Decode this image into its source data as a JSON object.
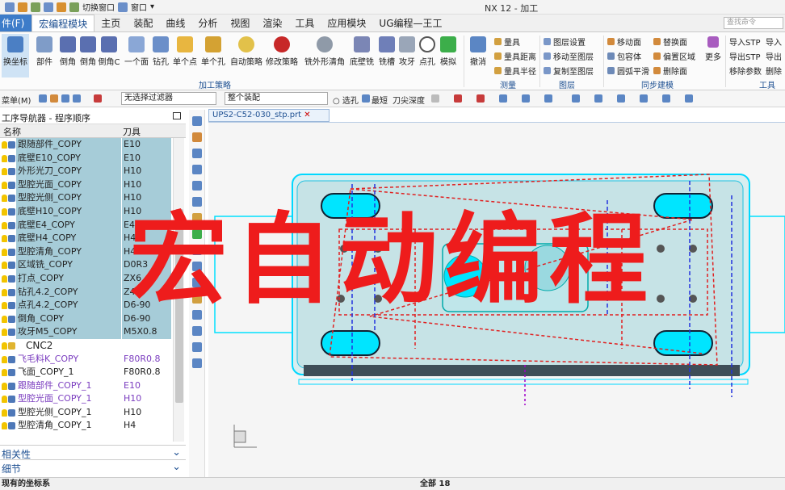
{
  "window": {
    "title": "NX 12 - 加工",
    "qat_switch_window": "切换窗口",
    "qat_window": "窗口"
  },
  "tabs": [
    {
      "label": "件(F)"
    },
    {
      "label": "宏编程模块"
    },
    {
      "label": "主页"
    },
    {
      "label": "装配"
    },
    {
      "label": "曲线"
    },
    {
      "label": "分析"
    },
    {
      "label": "视图"
    },
    {
      "label": "渲染"
    },
    {
      "label": "工具"
    },
    {
      "label": "应用模块"
    },
    {
      "label": "UG编程—王工"
    }
  ],
  "search": {
    "placeholder": "查找命令"
  },
  "ribbon": {
    "big_buttons": [
      {
        "label": "换坐标"
      },
      {
        "label": "部件"
      },
      {
        "label": "倒角"
      },
      {
        "label": "倒角"
      },
      {
        "label": "倒角C"
      },
      {
        "label": "一个面"
      },
      {
        "label": "钻孔"
      },
      {
        "label": "单个点"
      },
      {
        "label": "单个孔"
      },
      {
        "label": "自动策略"
      },
      {
        "label": "修改策略"
      },
      {
        "label": "铣外形清角"
      },
      {
        "label": "底壁铣"
      },
      {
        "label": "铣槽"
      },
      {
        "label": "攻牙"
      },
      {
        "label": "点孔"
      },
      {
        "label": "模拟"
      },
      {
        "label": "撤消"
      }
    ],
    "measure_items": [
      "量具",
      "量具距离",
      "量具半径"
    ],
    "layer_items": [
      "图层设置",
      "移动至图层",
      "复制至图层"
    ],
    "sync_items": [
      "移动面",
      "包容体",
      "圆弧平滑",
      "替换面",
      "偏置区域",
      "删除面"
    ],
    "more_label": "更多",
    "tool_items": [
      "导入STP",
      "导出STP",
      "移除参数",
      "导入",
      "导出",
      "删除"
    ],
    "group_labels": {
      "machining": "加工策略",
      "measure": "测量",
      "layer": "图层",
      "sync": "同步建模",
      "tools": "工具"
    }
  },
  "filterbar": {
    "menu": "菜单(M)",
    "filter": "无选择过滤器",
    "assembly": "整个装配",
    "select_hole": "选孔",
    "shortest": "最短",
    "tool_depth": "刀尖深度"
  },
  "navigator": {
    "title": "工序导航器 - 程序顺序",
    "col_name": "名称",
    "col_tool": "刀具",
    "rows": [
      {
        "name": "跟随部件_COPY",
        "tool": "E10",
        "sel": true
      },
      {
        "name": "底壁E10_COPY",
        "tool": "E10",
        "sel": true
      },
      {
        "name": "外形光刀_COPY",
        "tool": "H10",
        "sel": true
      },
      {
        "name": "型腔光面_COPY",
        "tool": "H10",
        "sel": true
      },
      {
        "name": "型腔光侧_COPY",
        "tool": "H10",
        "sel": true
      },
      {
        "name": "底壁H10_COPY",
        "tool": "H10",
        "sel": true
      },
      {
        "name": "底壁E4_COPY",
        "tool": "E4",
        "sel": true
      },
      {
        "name": "底壁H4_COPY",
        "tool": "H4",
        "sel": true
      },
      {
        "name": "型腔清角_COPY",
        "tool": "H4",
        "sel": true
      },
      {
        "name": "区域铣_COPY",
        "tool": "D0R3",
        "sel": true
      },
      {
        "name": "打点_COPY",
        "tool": "ZX6",
        "sel": true
      },
      {
        "name": "钻孔4.2_COPY",
        "tool": "Z4.2",
        "sel": true
      },
      {
        "name": "点孔4.2_COPY",
        "tool": "D6-90",
        "sel": true
      },
      {
        "name": "倒角_COPY",
        "tool": "D6-90",
        "sel": true
      },
      {
        "name": "攻牙M5_COPY",
        "tool": "M5X0.8",
        "sel": true
      },
      {
        "name": "CNC2",
        "tool": "",
        "sel": false,
        "group": true
      },
      {
        "name": "飞毛料K_COPY",
        "tool": "F80R0.8",
        "sel": false,
        "purple": true
      },
      {
        "name": "飞面_COPY_1",
        "tool": "F80R0.8",
        "sel": false
      },
      {
        "name": "跟随部件_COPY_1",
        "tool": "E10",
        "sel": false,
        "purple": true
      },
      {
        "name": "型腔光面_COPY_1",
        "tool": "H10",
        "sel": false,
        "purple": true
      },
      {
        "name": "型腔光侧_COPY_1",
        "tool": "H10",
        "sel": false
      },
      {
        "name": "型腔清角_COPY_1",
        "tool": "H4",
        "sel": false
      }
    ],
    "panel_dependencies": "相关性",
    "panel_details": "细节"
  },
  "viewport": {
    "doc_tab": "UPS2-C52-030_stp.prt"
  },
  "overlay_text": "宏自动编程",
  "status": {
    "left": "现有的坐标系",
    "center": "全部 18"
  },
  "colors": {
    "file_tab": "#3d7cc9",
    "selection": "#a6ccd8",
    "overlay": "#ee1c1c",
    "part_cyan": "#00e5ff"
  }
}
